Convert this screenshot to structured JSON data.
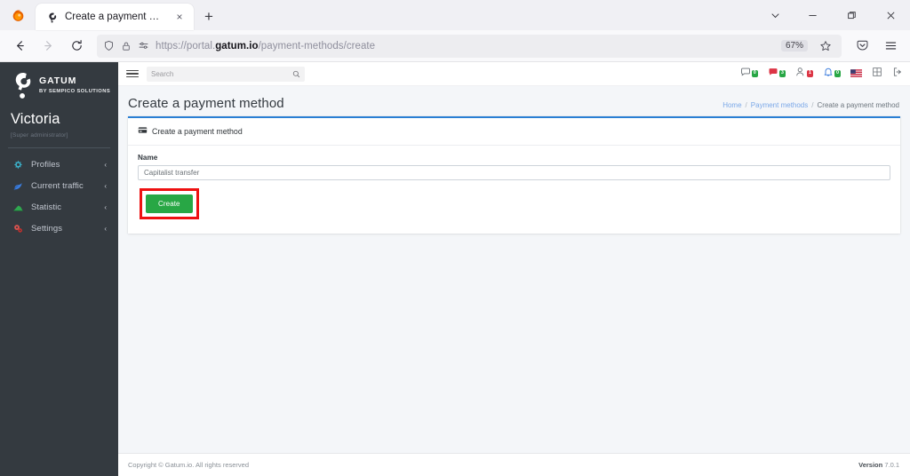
{
  "browser": {
    "tab": {
      "title": "Create a payment method",
      "favicon_name": "gatum-favicon",
      "close_label": "×"
    },
    "new_tab_label": "+",
    "window_controls": {
      "tab_list": "⌄",
      "minimize": "−",
      "maximize": "❐",
      "close": "×"
    },
    "toolbar": {
      "back": "←",
      "forward": "→",
      "reload": "⟳",
      "url_prefix": "https://portal.",
      "url_domain": "gatum.io",
      "url_suffix": "/payment-methods/create",
      "zoom_level": "67%",
      "bookmark_star": "☆",
      "pocket": "pocket-icon",
      "app_menu": "≡"
    }
  },
  "sidebar": {
    "brand": {
      "name": "GATUM",
      "subtitle": "BY SEMPICO SOLUTIONS"
    },
    "user": {
      "name": "Victoria",
      "role": "[Super administrator]"
    },
    "items": [
      {
        "label": "Profiles",
        "icon": "profiles-icon",
        "chevron": "‹",
        "color": "#3bb0c9"
      },
      {
        "label": "Current traffic",
        "icon": "traffic-icon",
        "chevron": "‹",
        "color": "#3b7ddd"
      },
      {
        "label": "Statistic",
        "icon": "statistic-icon",
        "chevron": "‹",
        "color": "#2fa84f"
      },
      {
        "label": "Settings",
        "icon": "settings-icon",
        "chevron": "‹",
        "color": "#d9534f"
      }
    ]
  },
  "topnav": {
    "menu_toggle": "hamburger-icon",
    "search": {
      "placeholder": "Search",
      "value": ""
    },
    "icons": [
      {
        "name": "chat-icon",
        "badge": "0",
        "badge_color": "green"
      },
      {
        "name": "support-icon",
        "badge": "3",
        "badge_color": "green"
      },
      {
        "name": "users-icon",
        "badge": "1",
        "badge_color": "red"
      },
      {
        "name": "bell-icon",
        "badge": "0",
        "badge_color": "green"
      },
      {
        "name": "flag-us-icon",
        "badge": "",
        "badge_color": ""
      },
      {
        "name": "grid-icon",
        "badge": "",
        "badge_color": ""
      },
      {
        "name": "logout-icon",
        "badge": "",
        "badge_color": ""
      }
    ]
  },
  "page": {
    "title": "Create a payment method",
    "breadcrumb": {
      "home": "Home",
      "parent": "Payment methods",
      "current": "Create a payment method",
      "separator": "/"
    }
  },
  "card": {
    "icon": "credit-card-icon",
    "header": "Create a payment method",
    "name_label": "Name",
    "name_value": "Capitalist transfer",
    "name_placeholder": "Name",
    "create_button": "Create",
    "highlight_color": "#ee1111",
    "button_color": "#28a745"
  },
  "footer": {
    "copyright": "Copyright © Gatum.io. All rights reserved",
    "version_label": "Version",
    "version_number": "7.0.1"
  }
}
